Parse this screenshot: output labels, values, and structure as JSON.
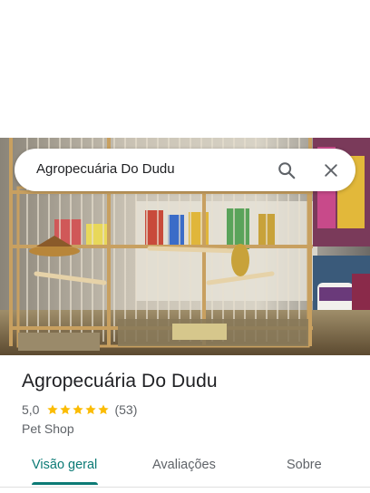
{
  "search": {
    "query": "Agropecuária Do Dudu"
  },
  "place": {
    "name": "Agropecuária Do Dudu",
    "rating": "5,0",
    "stars": 5,
    "review_count": "(53)",
    "category": "Pet Shop"
  },
  "tabs": [
    {
      "label": "Visão geral",
      "active": true
    },
    {
      "label": "Avaliações",
      "active": false
    },
    {
      "label": "Sobre",
      "active": false
    }
  ],
  "colors": {
    "accent": "#0b7a75",
    "star": "#fbbc04"
  },
  "icons": {
    "search": "search-icon",
    "close": "close-icon"
  }
}
